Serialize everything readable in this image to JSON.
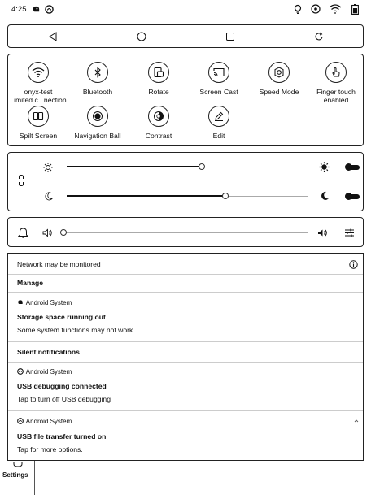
{
  "status_bar": {
    "time": "4:25",
    "left_icons": [
      "notification-icon",
      "debug-icon"
    ],
    "right_icons": [
      "frontlight-icon",
      "speed-icon",
      "wifi-icon",
      "battery-icon"
    ]
  },
  "nav_bar": {
    "buttons": [
      "back-triangle-icon",
      "home-circle-icon",
      "recents-square-icon",
      "refresh-icon"
    ]
  },
  "quick_settings": {
    "tiles": [
      {
        "label": "onyx-test\nLimited c...nection",
        "icon": "wifi-icon",
        "active": false
      },
      {
        "label": "Bluetooth",
        "icon": "bluetooth-icon",
        "active": false
      },
      {
        "label": "Rotate",
        "icon": "rotate-icon",
        "active": false
      },
      {
        "label": "Screen Cast",
        "icon": "cast-icon",
        "active": false
      },
      {
        "label": "Speed Mode",
        "icon": "speed-mode-icon",
        "active": false
      },
      {
        "label": "Finger touch\nenabled",
        "icon": "finger-touch-icon",
        "active": false
      },
      {
        "label": "Spilt Screen",
        "icon": "split-screen-icon",
        "active": false
      },
      {
        "label": "Navigation Ball",
        "icon": "navigation-ball-icon",
        "active": true
      },
      {
        "label": "Contrast",
        "icon": "contrast-icon",
        "active": false
      },
      {
        "label": "Edit",
        "icon": "edit-icon",
        "active": false
      }
    ]
  },
  "brightness": {
    "link_icon": "link-icon",
    "warm": {
      "icon_low": "sun-outline-icon",
      "icon_high": "sun-filled-icon",
      "level": 0.56,
      "toggle_on": true
    },
    "cold": {
      "icon_low": "moon-outline-icon",
      "icon_high": "moon-filled-icon",
      "level": 0.66,
      "toggle_on": true
    }
  },
  "volume": {
    "icon_left": "bell-icon",
    "icon_low": "speaker-low-icon",
    "icon_high": "speaker-high-icon",
    "settings_icon": "sliders-icon",
    "level": 0.0
  },
  "notifications": {
    "network_warning": "Network may be monitored",
    "info_icon": "info-icon",
    "manage": "Manage",
    "items": [
      {
        "source": "Android System",
        "title": "Storage space running out",
        "body": "Some system functions may not work",
        "icon": "notification-icon"
      },
      {
        "source": "Android System",
        "title": "USB debugging connected",
        "body": "Tap to turn off USB debugging",
        "icon": "debug-icon"
      },
      {
        "source": "Android System",
        "title": "USB file transfer turned on",
        "body": "Tap for more options.",
        "icon": "debug-icon"
      }
    ],
    "silent_header": "Silent notifications"
  },
  "bottom": {
    "settings_label": "Settings"
  }
}
